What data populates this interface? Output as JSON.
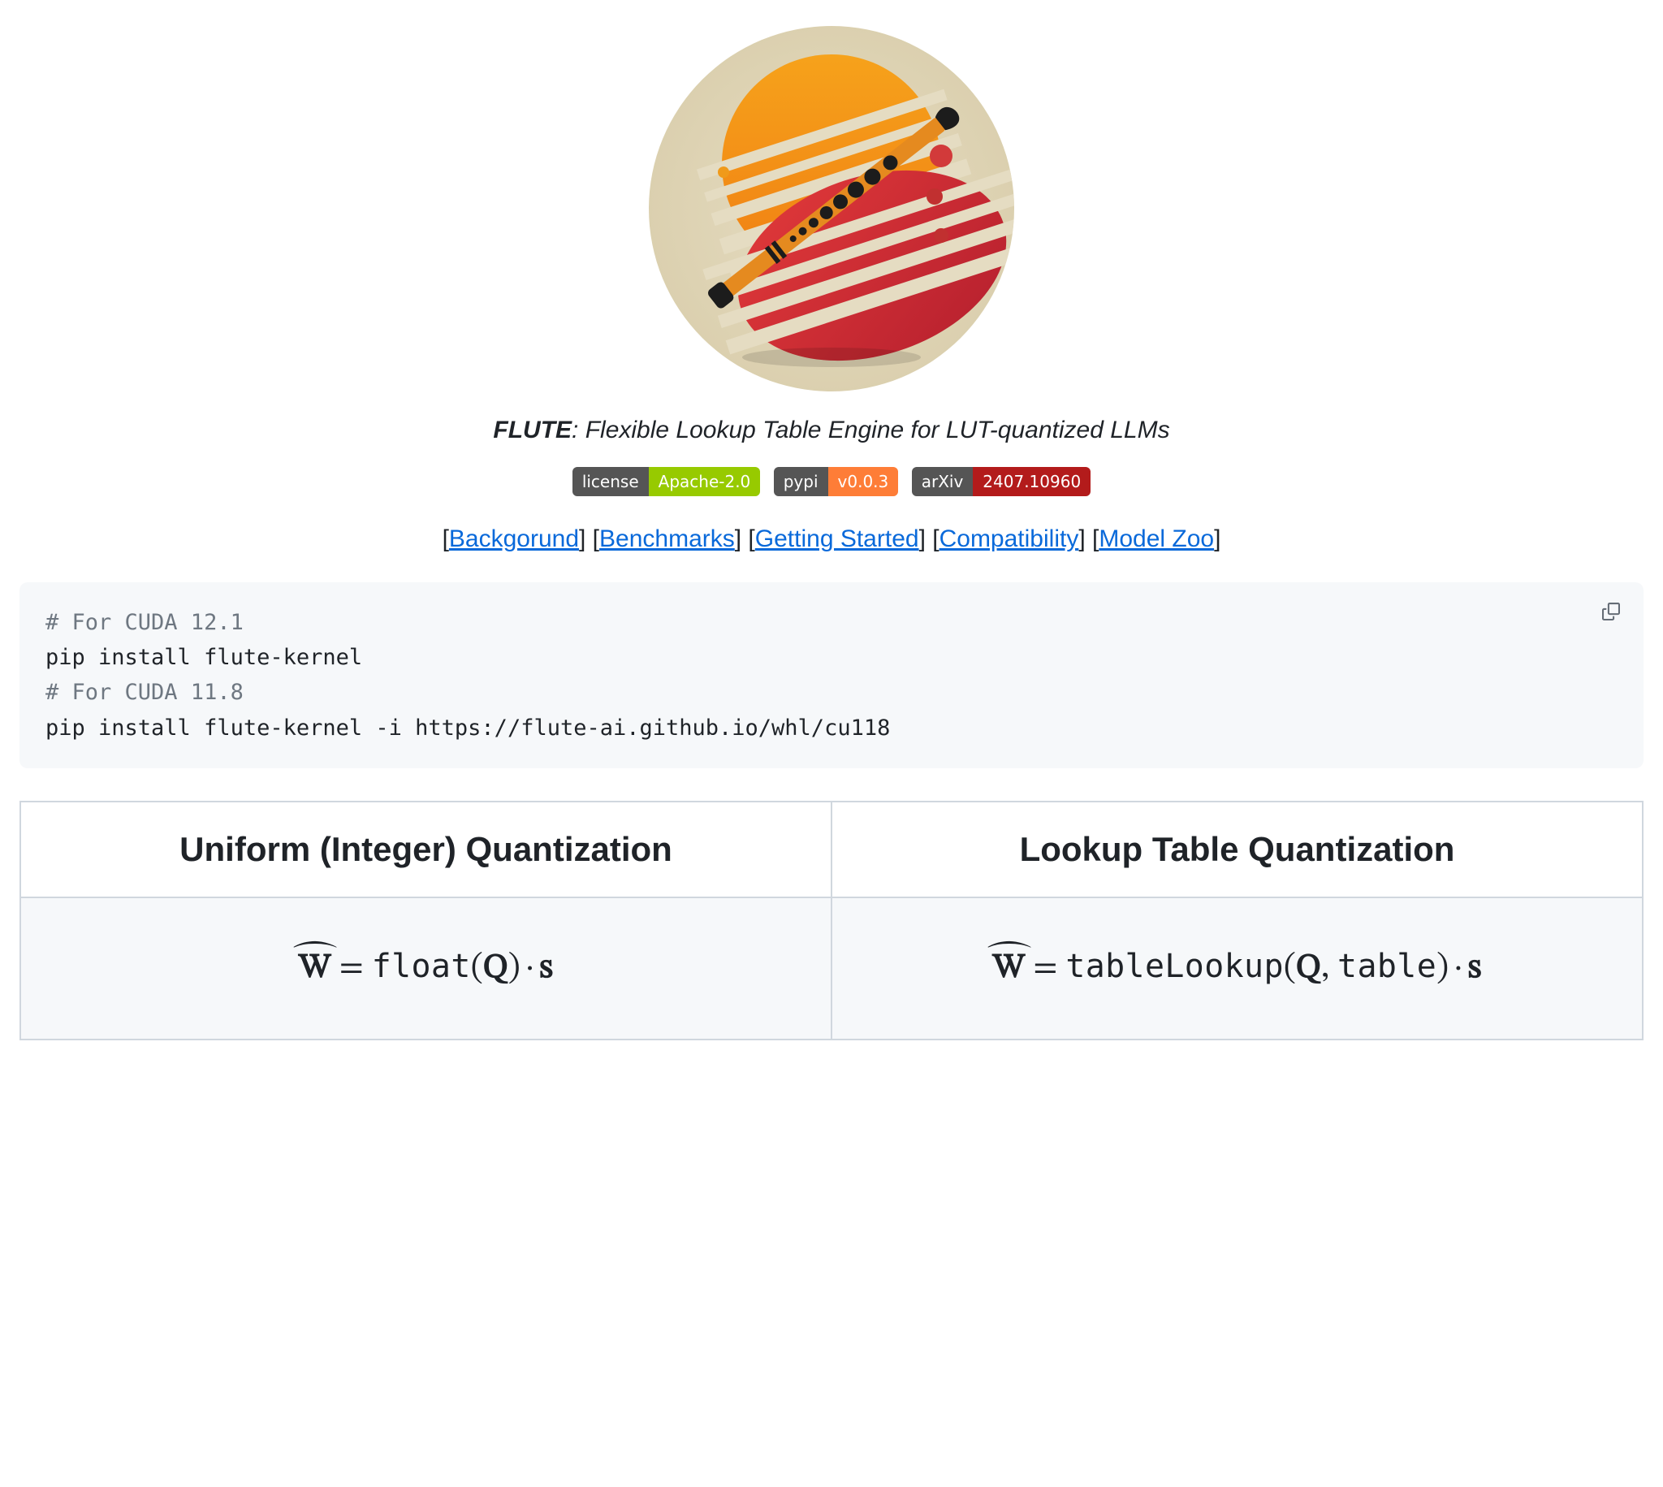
{
  "tagline": {
    "name": "FLUTE",
    "desc": ": Flexible Lookup Table Engine for LUT-quantized LLMs"
  },
  "badges": {
    "license": {
      "key": "license",
      "value": "Apache-2.0"
    },
    "pypi": {
      "key": "pypi",
      "value": "v0.0.3"
    },
    "arxiv": {
      "key": "arXiv",
      "value": "2407.10960"
    }
  },
  "nav": {
    "background": "Backgorund",
    "benchmarks": "Benchmarks",
    "getting": "Getting Started",
    "compat": "Compatibility",
    "zoo": "Model Zoo"
  },
  "code": {
    "c1": "# For CUDA 12.1",
    "l1": "pip install flute-kernel",
    "c2": "# For CUDA 11.8",
    "l2": "pip install flute-kernel -i https://flute-ai.github.io/whl/cu118"
  },
  "table": {
    "h1": "Uniform (Integer) Quantization",
    "h2": "Lookup Table Quantization",
    "f1": {
      "w": "W",
      "eq": " = ",
      "fn": "float",
      "lp": "(",
      "q": "Q",
      "rp": ")",
      "dot": "·",
      "s": "s"
    },
    "f2": {
      "w": "W",
      "eq": " = ",
      "fn": "tableLookup",
      "lp": "(",
      "q": "Q",
      "comma": ", ",
      "tbl": "table",
      "rp": ")",
      "dot": "·",
      "s": "s"
    }
  }
}
